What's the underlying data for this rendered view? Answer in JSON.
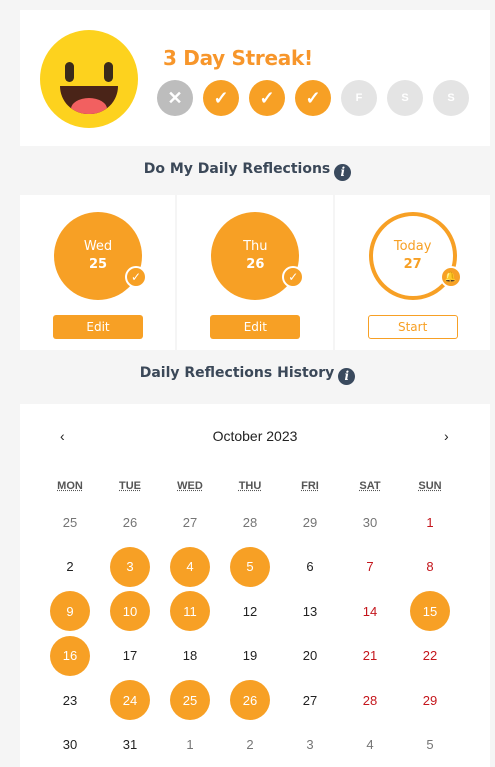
{
  "streak": {
    "title": "3 Day Streak!",
    "days": [
      {
        "label": "✕",
        "state": "missed"
      },
      {
        "label": "✓",
        "state": "done"
      },
      {
        "label": "✓",
        "state": "done"
      },
      {
        "label": "✓",
        "state": "done"
      },
      {
        "label": "F",
        "state": "future"
      },
      {
        "label": "S",
        "state": "future"
      },
      {
        "label": "S",
        "state": "future"
      }
    ]
  },
  "daily": {
    "title": "Do My Daily Reflections",
    "info_icon": "i",
    "cards": [
      {
        "day": "Wed",
        "date": "25",
        "button": "Edit",
        "badge": "✓"
      },
      {
        "day": "Thu",
        "date": "26",
        "button": "Edit",
        "badge": "✓"
      },
      {
        "day": "Today",
        "date": "27",
        "button": "Start",
        "badge": "🔔"
      }
    ]
  },
  "history": {
    "title": "Daily Reflections History",
    "info_icon": "i",
    "month": "October 2023",
    "prev": "‹",
    "next": "›",
    "weekdays": [
      "MON",
      "TUE",
      "WED",
      "THU",
      "FRI",
      "SAT",
      "SUN"
    ],
    "weeks": [
      [
        "25",
        "26",
        "27",
        "28",
        "29",
        "30",
        "1"
      ],
      [
        "2",
        "3",
        "4",
        "5",
        "6",
        "7",
        "8"
      ],
      [
        "9",
        "10",
        "11",
        "12",
        "13",
        "14",
        "15"
      ],
      [
        "16",
        "17",
        "18",
        "19",
        "20",
        "21",
        "22"
      ],
      [
        "23",
        "24",
        "25",
        "26",
        "27",
        "28",
        "29"
      ],
      [
        "30",
        "31",
        "1",
        "2",
        "3",
        "4",
        "5"
      ]
    ],
    "completed_days": [
      "3",
      "4",
      "5",
      "9",
      "10",
      "11",
      "15",
      "16",
      "24",
      "25",
      "26"
    ]
  },
  "colors": {
    "accent": "#f7a025",
    "weekend": "#c4161c",
    "missed": "#bdbdbd",
    "future": "#e4e4e4"
  }
}
